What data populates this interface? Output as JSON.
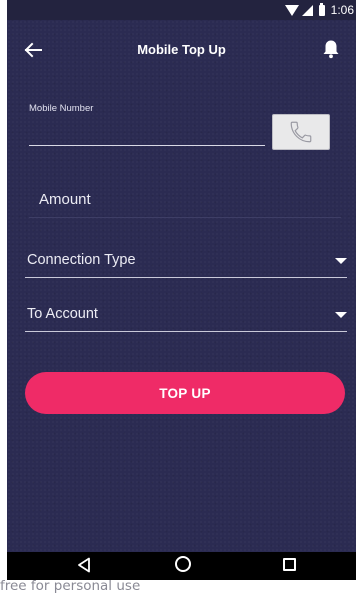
{
  "status_bar": {
    "time": "1:06"
  },
  "app_bar": {
    "title": "Mobile Top Up"
  },
  "form": {
    "mobile_number_label": "Mobile Number",
    "mobile_number_value": "",
    "amount_placeholder": "Amount",
    "connection_type_label": "Connection Type",
    "to_account_label": "To Account",
    "submit_label": "TOP UP"
  },
  "watermark": "free for personal use",
  "colors": {
    "background": "#2b2b52",
    "accent": "#ef2b67",
    "text": "#ffffff"
  },
  "icons": {
    "back": "arrow-left-icon",
    "notifications": "bell-icon",
    "contact": "phone-icon",
    "dropdown": "caret-down-icon"
  }
}
